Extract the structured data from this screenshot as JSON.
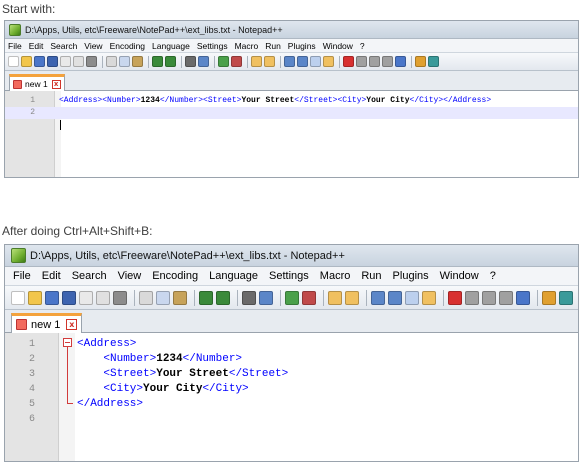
{
  "captions": {
    "before": "Start with:",
    "after": "After doing Ctrl+Alt+Shift+B:"
  },
  "window": {
    "title": "D:\\Apps, Utils, etc\\Freeware\\NotePad++\\ext_libs.txt - Notepad++",
    "menu": [
      "File",
      "Edit",
      "Search",
      "View",
      "Encoding",
      "Language",
      "Settings",
      "Macro",
      "Run",
      "Plugins",
      "Window",
      "?"
    ],
    "tab_label": "new 1",
    "tab_close": "x",
    "toolbar_icons": [
      "new-file-icon",
      "open-file-icon",
      "save-icon",
      "save-all-icon",
      "close-icon",
      "close-all-icon",
      "print-icon",
      "cut-icon",
      "copy-icon",
      "paste-icon",
      "undo-icon",
      "redo-icon",
      "find-icon",
      "replace-icon",
      "zoom-in-icon",
      "zoom-out-icon",
      "sync-vertical-icon",
      "sync-horizontal-icon",
      "word-wrap-icon",
      "show-all-chars-icon",
      "indent-guide-icon",
      "user-lang-icon",
      "record-macro-icon",
      "stop-record-icon",
      "play-macro-icon",
      "run-macro-multiple-icon",
      "save-macro-icon",
      "launch-browser-icon",
      "spell-check-icon"
    ]
  },
  "before": {
    "lines": [
      {
        "num": "1",
        "text": "<Address><Number>1234</Number><Street>Your Street</Street><City>Your City</City></Address>"
      },
      {
        "num": "2",
        "text": ""
      }
    ]
  },
  "after": {
    "lines": [
      {
        "num": "1",
        "text": "<Address>"
      },
      {
        "num": "2",
        "text": "    <Number>1234</Number>"
      },
      {
        "num": "3",
        "text": "    <Street>Your Street</Street>"
      },
      {
        "num": "4",
        "text": "    <City>Your City</City>"
      },
      {
        "num": "5",
        "text": "</Address>"
      },
      {
        "num": "6",
        "text": ""
      }
    ]
  }
}
